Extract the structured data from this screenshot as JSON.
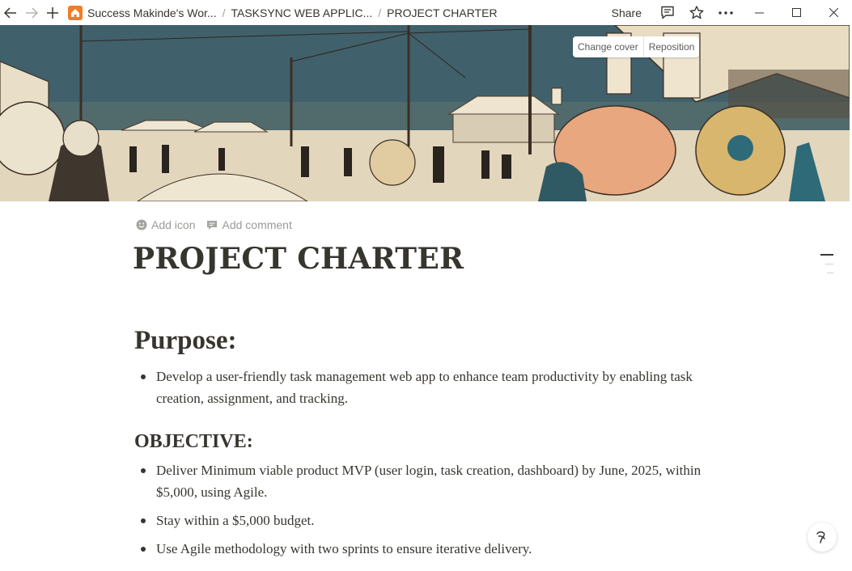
{
  "topbar": {
    "breadcrumbs": [
      {
        "label": "Success Makinde's Wor...",
        "icon": "home-icon"
      },
      {
        "label": "TASKSYNC WEB APPLIC..."
      },
      {
        "label": "PROJECT CHARTER"
      }
    ],
    "separator": "/",
    "share_label": "Share"
  },
  "cover": {
    "change_cover_label": "Change cover",
    "reposition_label": "Reposition"
  },
  "page_actions": {
    "add_icon_label": "Add icon",
    "add_comment_label": "Add comment"
  },
  "page": {
    "title": "PROJECT CHARTER"
  },
  "sections": {
    "purpose": {
      "heading": "Purpose:",
      "bullets": [
        "Develop a user-friendly task management web app to enhance team productivity by enabling task creation, assignment, and tracking."
      ]
    },
    "objective": {
      "heading": "OBJECTIVE:",
      "bullets": [
        "Deliver Minimum viable product MVP (user login, task creation, dashboard) by June, 2025, within $5,000, using Agile.",
        "Stay within a $5,000 budget.",
        "Use Agile methodology with two sprints to ensure iterative delivery."
      ]
    }
  },
  "help": {
    "glyph": "?"
  },
  "colors": {
    "text": "#37352f",
    "muted": "#9b9a97",
    "home_icon_bg": "#f27c26"
  }
}
